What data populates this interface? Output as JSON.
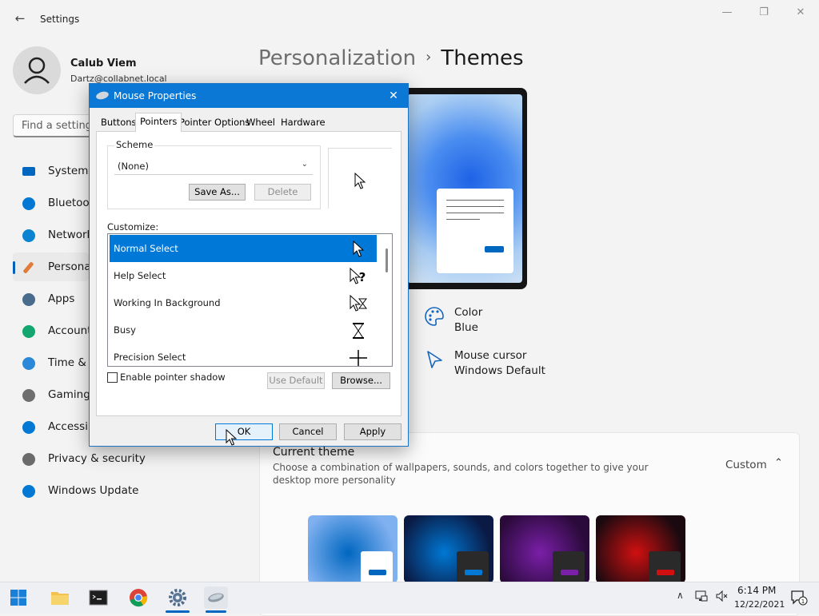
{
  "window": {
    "title": "Settings",
    "back": "←",
    "minimize": "—",
    "restore": "❐",
    "close": "✕"
  },
  "user": {
    "name": "Calub Viem",
    "email": "Dartz@collabnet.local"
  },
  "search": {
    "placeholder": "Find a setting"
  },
  "nav": [
    {
      "label": "System",
      "icon": "system-icon",
      "color": "#0067c0"
    },
    {
      "label": "Bluetoot",
      "icon": "bluetooth-icon",
      "color": "#0078d4"
    },
    {
      "label": "Network",
      "icon": "wifi-icon",
      "color": "#0a84d0"
    },
    {
      "label": "Personal",
      "icon": "brush-icon",
      "color": "#e07b39"
    },
    {
      "label": "Apps",
      "icon": "apps-icon",
      "color": "#4a6c8c"
    },
    {
      "label": "Account",
      "icon": "account-icon",
      "color": "#13a66e"
    },
    {
      "label": "Time & l",
      "icon": "clock-icon",
      "color": "#2b88d8"
    },
    {
      "label": "Gaming",
      "icon": "gamepad-icon",
      "color": "#6e6e6e"
    },
    {
      "label": "Accessib",
      "icon": "accessibility-icon",
      "color": "#0078d4"
    },
    {
      "label": "Privacy & security",
      "icon": "shield-icon",
      "color": "#6b6b6b"
    },
    {
      "label": "Windows Update",
      "icon": "update-icon",
      "color": "#0078d4"
    }
  ],
  "breadcrumb": {
    "parent": "Personalization",
    "sep": "›",
    "current": "Themes"
  },
  "properties": {
    "color_title": "Color",
    "color_value": "Blue",
    "cursor_title": "Mouse cursor",
    "cursor_value": "Windows Default"
  },
  "current_theme": {
    "title": "Current theme",
    "description": "Choose a combination of wallpapers, sounds, and colors together to give your desktop more personality",
    "state": "Custom",
    "chevron": "⌃"
  },
  "theme_thumbs": [
    {
      "bg": "#7fb0f0",
      "accent": "#0067c0",
      "mini": "#ffffff"
    },
    {
      "bg": "#0a1a44",
      "accent": "#0078d4",
      "mini": "#2a2a2a"
    },
    {
      "bg": "#2a0a3a",
      "accent": "#7a1fa8",
      "mini": "#2a2a2a"
    },
    {
      "bg": "#1a0a10",
      "accent": "#d01010",
      "mini": "#2a2a2a"
    }
  ],
  "clock": {
    "time": "6:14 PM",
    "date": "12/22/2021"
  },
  "dialog": {
    "title": "Mouse Properties",
    "close": "✕",
    "tabs": [
      "Buttons",
      "Pointers",
      "Pointer Options",
      "Wheel",
      "Hardware"
    ],
    "scheme_label": "Scheme",
    "scheme_value": "(None)",
    "scheme_chevron": "⌄",
    "save_as": "Save As...",
    "delete": "Delete",
    "customize_label": "Customize:",
    "cursors": [
      {
        "label": "Normal Select",
        "icon": "arrow-cursor-icon"
      },
      {
        "label": "Help Select",
        "icon": "help-cursor-icon"
      },
      {
        "label": "Working In Background",
        "icon": "working-cursor-icon"
      },
      {
        "label": "Busy",
        "icon": "hourglass-cursor-icon"
      },
      {
        "label": "Precision Select",
        "icon": "crosshair-cursor-icon"
      }
    ],
    "shadow_label": "Enable pointer shadow",
    "use_default": "Use Default",
    "browse": "Browse...",
    "ok": "OK",
    "cancel": "Cancel",
    "apply": "Apply"
  }
}
